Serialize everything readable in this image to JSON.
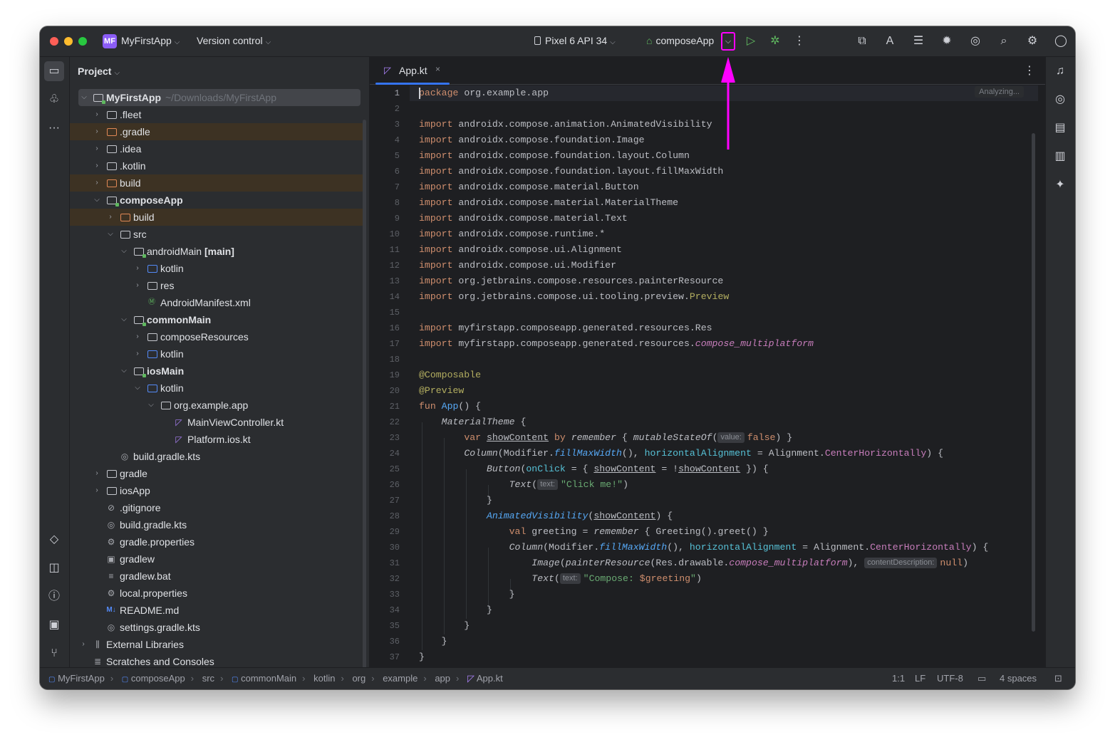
{
  "titlebar": {
    "project_badge": "MF",
    "project_name": "MyFirstApp",
    "version_control": "Version control",
    "device": "Pixel 6 API 34",
    "run_config": "composeApp",
    "more": "⋮",
    "annotation_color": "#ff00ff"
  },
  "project_panel": {
    "title": "Project",
    "root_name": "MyFirstApp",
    "root_path": "~/Downloads/MyFirstApp",
    "items": [
      {
        "label": ".fleet"
      },
      {
        "label": ".gradle"
      },
      {
        "label": ".idea"
      },
      {
        "label": ".kotlin"
      },
      {
        "label": "build"
      },
      {
        "label": "composeApp"
      },
      {
        "label": "build"
      },
      {
        "label": "src"
      },
      {
        "label": "androidMain",
        "suffix": "[main]"
      },
      {
        "label": "kotlin"
      },
      {
        "label": "res"
      },
      {
        "label": "AndroidManifest.xml"
      },
      {
        "label": "commonMain"
      },
      {
        "label": "composeResources"
      },
      {
        "label": "kotlin"
      },
      {
        "label": "iosMain"
      },
      {
        "label": "kotlin"
      },
      {
        "label": "org.example.app"
      },
      {
        "label": "MainViewController.kt"
      },
      {
        "label": "Platform.ios.kt"
      },
      {
        "label": "build.gradle.kts"
      },
      {
        "label": "gradle"
      },
      {
        "label": "iosApp"
      },
      {
        "label": ".gitignore"
      },
      {
        "label": "build.gradle.kts"
      },
      {
        "label": "gradle.properties"
      },
      {
        "label": "gradlew"
      },
      {
        "label": "gradlew.bat"
      },
      {
        "label": "local.properties"
      },
      {
        "label": "README.md"
      },
      {
        "label": "settings.gradle.kts"
      },
      {
        "label": "External Libraries"
      },
      {
        "label": "Scratches and Consoles"
      }
    ]
  },
  "editor": {
    "tab_name": "App.kt",
    "status": "Analyzing...",
    "line_numbers": [
      "1",
      "2",
      "3",
      "4",
      "5",
      "6",
      "7",
      "8",
      "9",
      "10",
      "11",
      "12",
      "13",
      "14",
      "15",
      "16",
      "17",
      "18",
      "19",
      "20",
      "21",
      "22",
      "23",
      "24",
      "25",
      "26",
      "27",
      "28",
      "29",
      "30",
      "31",
      "32",
      "33",
      "34",
      "35",
      "36",
      "37"
    ],
    "code": {
      "pkg_kw": "package",
      "pkg_name": " org.example.app",
      "import_kw": "import",
      "i1": " androidx.compose.animation.AnimatedVisibility",
      "i2": " androidx.compose.foundation.Image",
      "i3": " androidx.compose.foundation.layout.Column",
      "i4": " androidx.compose.foundation.layout.fillMaxWidth",
      "i5": " androidx.compose.material.Button",
      "i6": " androidx.compose.material.MaterialTheme",
      "i7": " androidx.compose.material.Text",
      "i8": " androidx.compose.runtime.*",
      "i9": " androidx.compose.ui.Alignment",
      "i10": " androidx.compose.ui.Modifier",
      "i11": " org.jetbrains.compose.resources.painterResource",
      "i12a": " org.jetbrains.compose.ui.tooling.preview.",
      "i12b": "Preview",
      "i13": " myfirstapp.composeapp.generated.resources.Res",
      "i14a": " myfirstapp.composeapp.generated.resources.",
      "i14b": "compose_multiplatform",
      "a_composable": "@Composable",
      "a_preview": "@Preview",
      "fun_kw": "fun",
      "fun_name": " App",
      "fun_rest": "() {",
      "l22a": "MaterialTheme",
      "l22b": " {",
      "var_kw": "var",
      "show": "showContent",
      "by_kw": " by ",
      "remember": "remember",
      "l23c": " { ",
      "mutable": "mutableStateOf",
      "paren_open": "(",
      "hint_value": "value:",
      "false_kw": "false",
      "l23d": ") }",
      "column": "Column",
      "l24a": "(Modifier.",
      "fill": "fillMaxWidth",
      "l24b": "(), ",
      "halign": "horizontalAlignment",
      "eq": " = ",
      "align": "Alignment.",
      "center": "CenterHorizontally",
      "l24c": ") {",
      "button": "Button",
      "onclick": "onClick",
      "l25a": " = { ",
      "l25b": " = !",
      "l25c": " }) {",
      "text_fn": "Text",
      "hint_text": "text:",
      "str_click": "\"Click me!\"",
      "close_paren": ")",
      "close_brace": "}",
      "anim": "AnimatedVisibility",
      "l28b": ") {",
      "val_kw": "val",
      "l29a": " greeting = ",
      "l29b": " { Greeting().greet() }",
      "image": "Image",
      "painter": "painterResource",
      "l31a": "(Res.drawable.",
      "cmp": "compose_multiplatform",
      "l31b": "), ",
      "hint_cd": "contentDescription:",
      "null_kw": "null",
      "l31c": ")",
      "str_compose_a": "\"Compose: ",
      "str_compose_b": "$greeting",
      "str_compose_c": "\""
    }
  },
  "statusbar": {
    "crumbs": [
      "MyFirstApp",
      "composeApp",
      "src",
      "commonMain",
      "kotlin",
      "org",
      "example",
      "app",
      "App.kt"
    ],
    "position": "1:1",
    "line_sep": "LF",
    "encoding": "UTF-8",
    "indent": "4 spaces"
  }
}
